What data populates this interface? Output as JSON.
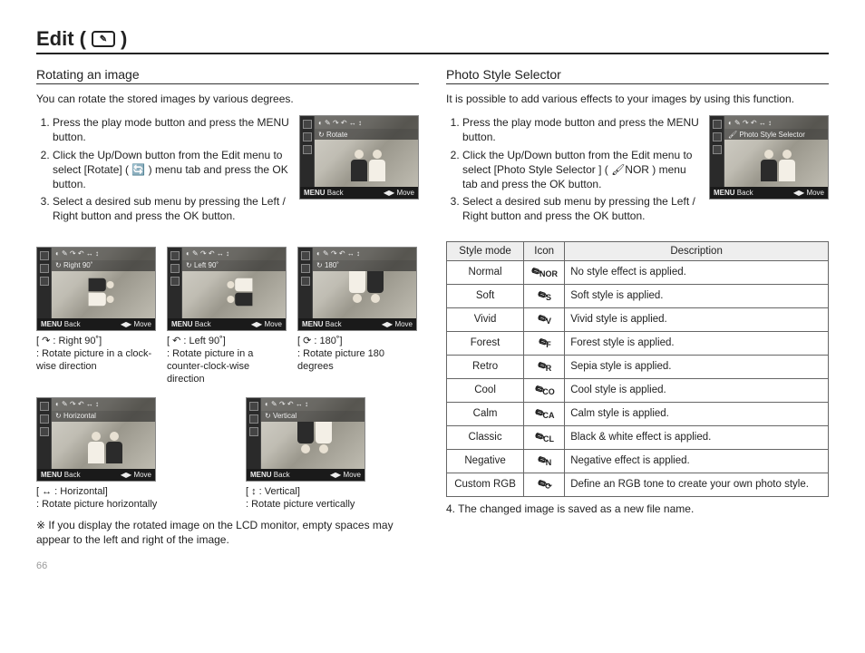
{
  "page": {
    "title": "Edit (",
    "title_close": ")",
    "number": "66",
    "title_icon_name": "edit-palette-icon"
  },
  "left": {
    "subhead": "Rotating an image",
    "intro": "You can rotate the stored images by various degrees.",
    "steps": [
      "Press the play mode button and press the MENU button.",
      "Click the Up/Down button from the Edit menu to select [Rotate] ( 🔄 ) menu tab and press the OK button.",
      "Select a desired sub menu by pressing the Left / Right button and press the OK button."
    ],
    "main_lcd": {
      "banner": "Rotate",
      "back": "Back",
      "move": "Move"
    },
    "thumbs_row1": [
      {
        "banner": "Right 90˚",
        "caption_line1": "[ ↷ : Right 90˚]",
        "caption_line2": ": Rotate picture in a clock-wise direction",
        "back": "Back",
        "move": "Move",
        "rotate_class": "rot90cw"
      },
      {
        "banner": "Left 90˚",
        "caption_line1": "[ ↶ : Left 90˚]",
        "caption_line2": ": Rotate picture in a counter-clock-wise direction",
        "back": "Back",
        "move": "Move",
        "rotate_class": "rot90ccw"
      },
      {
        "banner": "180˚",
        "caption_line1": "[ ⟳ : 180˚]",
        "caption_line2": ": Rotate picture 180 degrees",
        "back": "Back",
        "move": "Move",
        "rotate_class": "rot180"
      }
    ],
    "thumbs_row2": [
      {
        "banner": "Horizontal",
        "caption_line1": "[ ↔ : Horizontal]",
        "caption_line2": ": Rotate picture horizontally",
        "back": "Back",
        "move": "Move",
        "rotate_class": "flipH"
      },
      {
        "banner": "Vertical",
        "caption_line1": "[ ↕ : Vertical]",
        "caption_line2": ": Rotate picture vertically",
        "back": "Back",
        "move": "Move",
        "rotate_class": "flipV"
      }
    ],
    "note": "If you display the rotated image on the LCD monitor, empty spaces may appear to the left and right of the image."
  },
  "right": {
    "subhead": "Photo Style Selector",
    "intro": "It is possible to add various effects to your images by using this function.",
    "steps": [
      "Press the play mode button and press the MENU button.",
      "Click the Up/Down button from the Edit menu to select [Photo Style Selector ] ( 🖌NOR ) menu tab and press the OK button.",
      "Select a desired sub menu by pressing the Left / Right button and press the OK button."
    ],
    "main_lcd": {
      "banner": "Photo Style Selector",
      "back": "Back",
      "move": "Move"
    },
    "table": {
      "headers": [
        "Style mode",
        "Icon",
        "Description"
      ],
      "rows": [
        {
          "mode": "Normal",
          "icon_sub": "NOR",
          "desc": "No style effect is applied."
        },
        {
          "mode": "Soft",
          "icon_sub": "S",
          "desc": "Soft style is applied."
        },
        {
          "mode": "Vivid",
          "icon_sub": "V",
          "desc": "Vivid style is applied."
        },
        {
          "mode": "Forest",
          "icon_sub": "F",
          "desc": "Forest style is applied."
        },
        {
          "mode": "Retro",
          "icon_sub": "R",
          "desc": "Sepia style is applied."
        },
        {
          "mode": "Cool",
          "icon_sub": "CO",
          "desc": "Cool style is applied."
        },
        {
          "mode": "Calm",
          "icon_sub": "CA",
          "desc": "Calm style is applied."
        },
        {
          "mode": "Classic",
          "icon_sub": "CL",
          "desc": "Black & white effect is applied."
        },
        {
          "mode": "Negative",
          "icon_sub": "N",
          "desc": "Negative effect is applied."
        },
        {
          "mode": "Custom RGB",
          "icon_sub": "⟳",
          "desc": "Define an RGB tone to create your own photo style."
        }
      ]
    },
    "closing": "4. The changed image is saved as a new file name."
  }
}
